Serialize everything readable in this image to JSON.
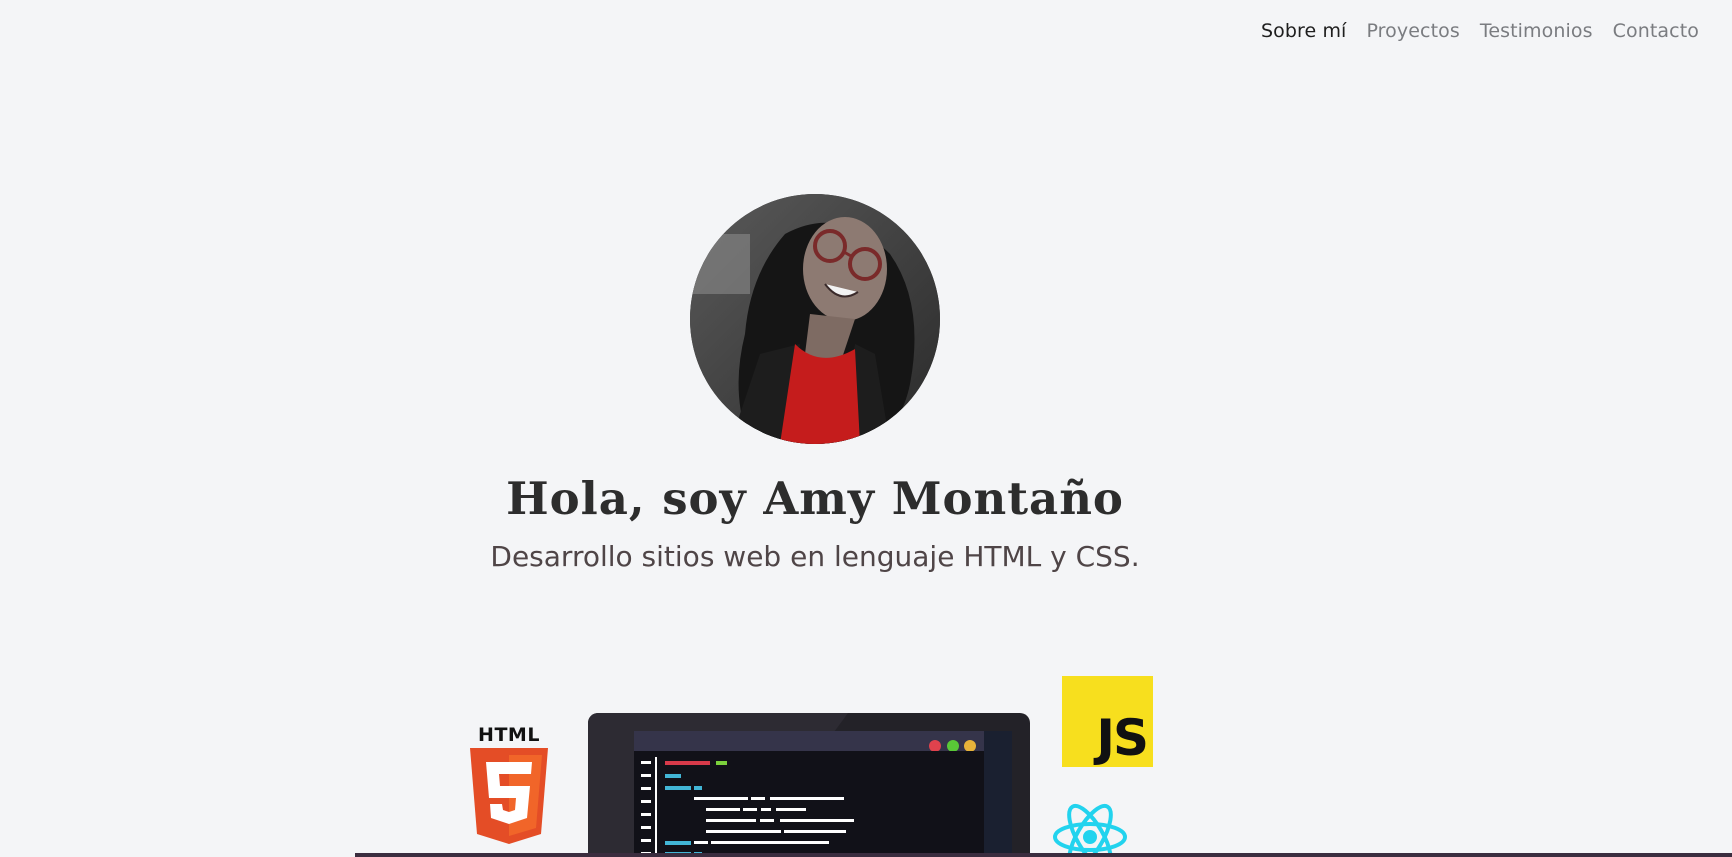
{
  "nav": {
    "items": [
      {
        "label": "Sobre mí",
        "active": true
      },
      {
        "label": "Proyectos",
        "active": false
      },
      {
        "label": "Testimonios",
        "active": false
      },
      {
        "label": "Contacto",
        "active": false
      }
    ]
  },
  "hero": {
    "title": "Hola, soy Amy Montaño",
    "subtitle": "Desarrollo sitios web en lenguaje HTML y CSS."
  },
  "tech": {
    "html_label": "HTML",
    "html_badge": "5",
    "js_label": "JS"
  },
  "colors": {
    "background": "#f4f5f7",
    "nav_active": "#1e1e1e",
    "nav_inactive": "#7a7c80",
    "html_orange": "#e44d26",
    "js_yellow": "#f7df1e",
    "react_cyan": "#22d3ee"
  }
}
